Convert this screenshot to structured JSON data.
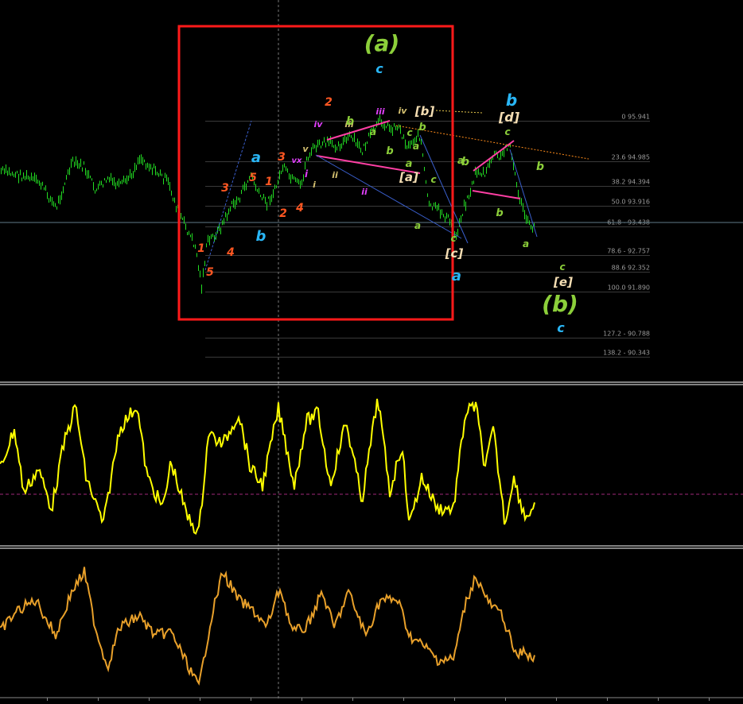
{
  "chart_data": [
    {
      "type": "candlestick",
      "panel": "price",
      "fib_levels": [
        {
          "label": "0 95.941",
          "value": 95.941
        },
        {
          "label": "23.6 94.985",
          "value": 94.985
        },
        {
          "label": "38.2 94.394",
          "value": 94.394
        },
        {
          "label": "50.0 93.916",
          "value": 93.916
        },
        {
          "label": "61.8 - 93.438",
          "value": 93.438
        },
        {
          "label": "78.6 - 92.757",
          "value": 92.757
        },
        {
          "label": "88.6 92.352",
          "value": 92.352
        },
        {
          "label": "100.0 91.890",
          "value": 91.89
        },
        {
          "label": "127.2 - 90.788",
          "value": 90.788
        },
        {
          "label": "138.2 - 90.343",
          "value": 90.343
        }
      ],
      "wave_labels": [
        {
          "text": "(a)",
          "color": "#8ccf3a",
          "size": 28
        },
        {
          "text": "c",
          "color": "#29b6f6",
          "size": 16
        },
        {
          "text": "b",
          "color": "#29b6f6",
          "size": 20
        },
        {
          "text": "[d]",
          "color": "#f5deb3",
          "size": 16
        },
        {
          "text": "(b)",
          "color": "#8ccf3a",
          "size": 28
        },
        {
          "text": "c",
          "color": "#29b6f6",
          "size": 16
        },
        {
          "text": "[e]",
          "color": "#f5deb3",
          "size": 15
        },
        {
          "text": "c",
          "color": "#8ccf3a",
          "size": 12
        },
        {
          "text": "[b]",
          "color": "#f5deb3",
          "size": 15
        },
        {
          "text": "[a]",
          "color": "#f5deb3",
          "size": 15
        },
        {
          "text": "[c]",
          "color": "#f5deb3",
          "size": 15
        },
        {
          "text": "a",
          "color": "#29b6f6",
          "size": 18
        },
        {
          "text": "a",
          "color": "#29b6f6",
          "size": 18
        },
        {
          "text": "b",
          "color": "#29b6f6",
          "size": 18
        },
        {
          "text": "5",
          "color": "#ff5722",
          "size": 14
        },
        {
          "text": "3",
          "color": "#ff5722",
          "size": 14
        },
        {
          "text": "1",
          "color": "#ff5722",
          "size": 14
        },
        {
          "text": "3",
          "color": "#ff5722",
          "size": 14
        },
        {
          "text": "5",
          "color": "#ff5722",
          "size": 14
        },
        {
          "text": "4",
          "color": "#ff5722",
          "size": 14
        },
        {
          "text": "2",
          "color": "#ff5722",
          "size": 14
        },
        {
          "text": "1",
          "color": "#ff5722",
          "size": 14
        },
        {
          "text": "4",
          "color": "#ff5722",
          "size": 14
        },
        {
          "text": "2",
          "color": "#ff5722",
          "size": 14
        },
        {
          "text": "iii",
          "color": "#e040fb",
          "size": 11
        },
        {
          "text": "vx",
          "color": "#e040fb",
          "size": 10
        },
        {
          "text": "i",
          "color": "#e040fb",
          "size": 12
        },
        {
          "text": "ii",
          "color": "#e040fb",
          "size": 11
        },
        {
          "text": "iv",
          "color": "#e040fb",
          "size": 11
        },
        {
          "text": "iii",
          "color": "#d4c070",
          "size": 11
        },
        {
          "text": "v",
          "color": "#d4c070",
          "size": 11
        },
        {
          "text": "i",
          "color": "#d4c070",
          "size": 11
        },
        {
          "text": "ii",
          "color": "#d4c070",
          "size": 11
        },
        {
          "text": "iv",
          "color": "#d4c070",
          "size": 11
        },
        {
          "text": "b",
          "color": "#8ccf3a",
          "size": 13
        },
        {
          "text": "c",
          "color": "#8ccf3a",
          "size": 12
        },
        {
          "text": "a",
          "color": "#8ccf3a",
          "size": 12
        },
        {
          "text": "b",
          "color": "#8ccf3a",
          "size": 13
        },
        {
          "text": "a",
          "color": "#8ccf3a",
          "size": 13
        },
        {
          "text": "c",
          "color": "#8ccf3a",
          "size": 12
        },
        {
          "text": "b",
          "color": "#8ccf3a",
          "size": 14
        },
        {
          "text": "a",
          "color": "#8ccf3a",
          "size": 12
        },
        {
          "text": "a",
          "color": "#8ccf3a",
          "size": 12
        },
        {
          "text": "b",
          "color": "#8ccf3a",
          "size": 13
        },
        {
          "text": "c",
          "color": "#8ccf3a",
          "size": 12
        },
        {
          "text": "b",
          "color": "#8ccf3a",
          "size": 14
        },
        {
          "text": "a",
          "color": "#8ccf3a",
          "size": 12
        },
        {
          "text": "b",
          "color": "#8ccf3a",
          "size": 14
        },
        {
          "text": "a",
          "color": "#8ccf3a",
          "size": 12
        },
        {
          "text": "c",
          "color": "#8ccf3a",
          "size": 12
        }
      ],
      "colors": {
        "candles": "#22dd22",
        "box": "#ff1a1a",
        "channel": "#ff3fa4",
        "trendline": "#3a5fcd",
        "fib_line": "#3a3a3a",
        "dotted": "#ff8c1a"
      }
    },
    {
      "type": "line",
      "panel": "oscillator-1",
      "color": "#ffff00",
      "series_shape": "oscillating"
    },
    {
      "type": "line",
      "panel": "oscillator-2",
      "color": "#e8a02a",
      "series_shape": "oscillating"
    }
  ]
}
